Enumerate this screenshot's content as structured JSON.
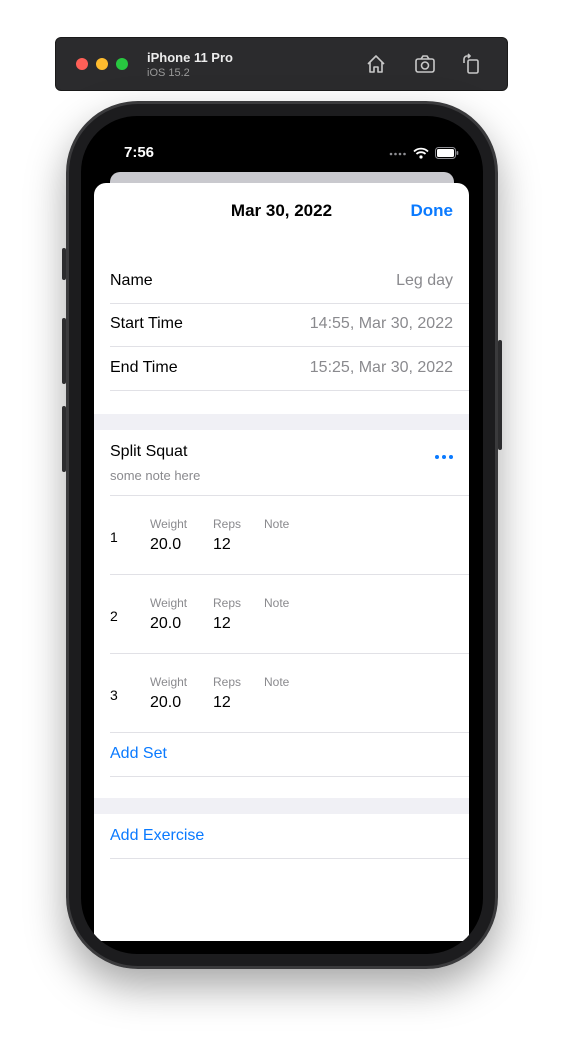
{
  "simulator": {
    "device_name": "iPhone 11 Pro",
    "os_version": "iOS 15.2",
    "icons": [
      "home-icon",
      "screenshot-icon",
      "rotate-icon"
    ]
  },
  "status_bar": {
    "time": "7:56"
  },
  "nav": {
    "title": "Mar 30, 2022",
    "done_label": "Done"
  },
  "details": [
    {
      "label": "Name",
      "value": "Leg day"
    },
    {
      "label": "Start Time",
      "value": "14:55, Mar 30, 2022"
    },
    {
      "label": "End Time",
      "value": "15:25, Mar 30, 2022"
    }
  ],
  "exercise": {
    "name": "Split Squat",
    "note": "some note here",
    "more_icon": "ellipsis-icon",
    "headers": {
      "weight": "Weight",
      "reps": "Reps",
      "note": "Note"
    },
    "sets": [
      {
        "number": "1",
        "weight": "20.0",
        "reps": "12",
        "note": ""
      },
      {
        "number": "2",
        "weight": "20.0",
        "reps": "12",
        "note": ""
      },
      {
        "number": "3",
        "weight": "20.0",
        "reps": "12",
        "note": ""
      }
    ],
    "add_set_label": "Add Set"
  },
  "add_exercise_label": "Add Exercise",
  "colors": {
    "accent": "#0a7aff",
    "secondary_text": "#8a8a8e",
    "group_background": "#f0f0f5"
  }
}
